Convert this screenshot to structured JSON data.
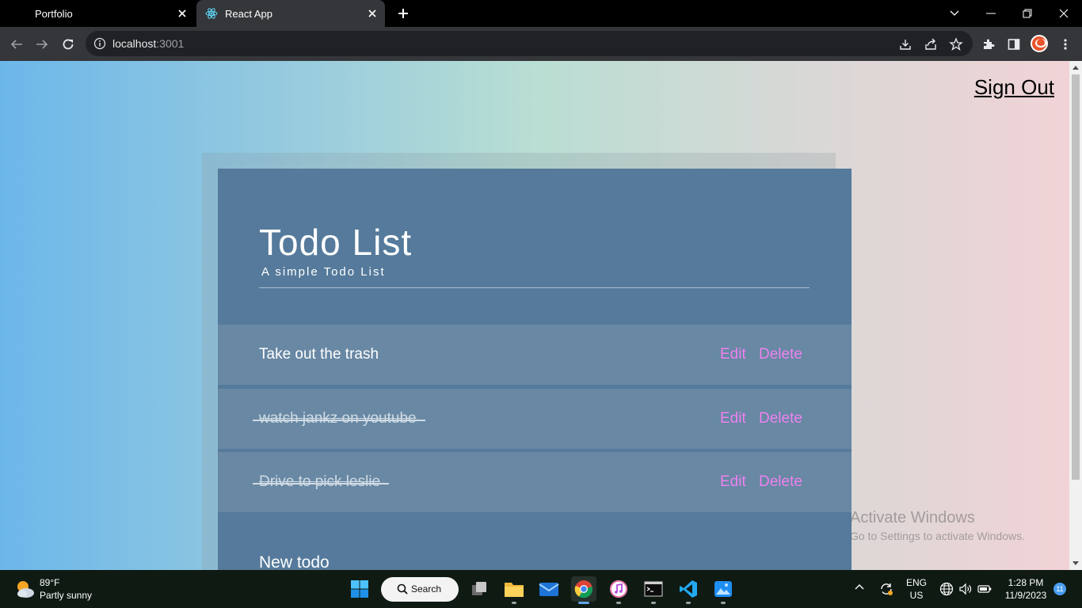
{
  "browser": {
    "tabs": [
      {
        "label": "Portfolio",
        "active": false
      },
      {
        "label": "React App",
        "active": true
      }
    ],
    "url_host": "localhost",
    "url_port": ":3001"
  },
  "page": {
    "sign_out": "Sign Out",
    "title": "Todo List",
    "subtitle": "A simple Todo List",
    "todos": [
      {
        "text": "Take out the trash",
        "completed": false,
        "edit": "Edit",
        "delete": "Delete"
      },
      {
        "text": "watch jankz on youtube",
        "completed": true,
        "edit": "Edit",
        "delete": "Delete"
      },
      {
        "text": "Drive to pick leslie",
        "completed": true,
        "edit": "Edit",
        "delete": "Delete"
      }
    ],
    "new_todo_label": "New todo"
  },
  "watermark": {
    "line1": "Activate Windows",
    "line2": "Go to Settings to activate Windows."
  },
  "taskbar": {
    "weather_temp": "89°F",
    "weather_desc": "Partly sunny",
    "search_label": "Search",
    "lang_line1": "ENG",
    "lang_line2": "US",
    "time": "1:28 PM",
    "date": "11/9/2023",
    "notification_count": "11"
  },
  "colors": {
    "card": "#557a9b",
    "todo_row": "#6888a4",
    "action_link": "#ee82ee"
  }
}
